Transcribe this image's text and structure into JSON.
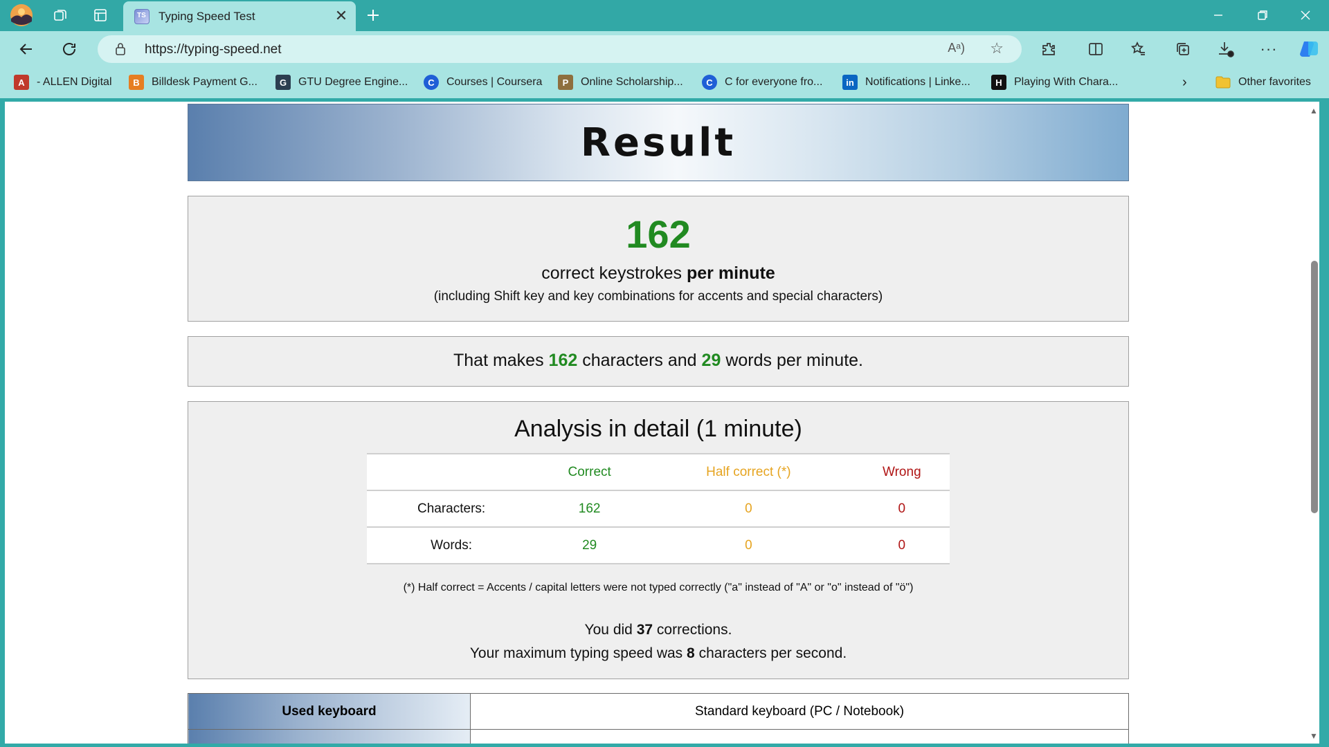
{
  "browser": {
    "tab_title": "Typing Speed Test",
    "tab_favicon_text": "TS",
    "url": "https://typing-speed.net",
    "read_aloud_icon": "A",
    "icons": [
      "profile-avatar-icon",
      "workspaces-icon",
      "vertical-tabs-icon",
      "new-tab-icon",
      "back-icon",
      "refresh-icon",
      "lock-icon",
      "star-icon",
      "extensions-icon",
      "split-screen-icon",
      "favorites-icon",
      "collections-icon",
      "downloads-icon",
      "more-icon",
      "copilot-icon"
    ],
    "favorites": [
      {
        "label": "- ALLEN Digital",
        "icon_color": "#c0392b",
        "icon_text": "A"
      },
      {
        "label": "Billdesk Payment G...",
        "icon_color": "#e67e22",
        "icon_text": "B"
      },
      {
        "label": "GTU Degree Engine...",
        "icon_color": "#2c3e50",
        "icon_text": "G"
      },
      {
        "label": "Courses | Coursera",
        "icon_color": "#1f5fd6",
        "icon_text": "C"
      },
      {
        "label": "Online Scholarship...",
        "icon_color": "#8e6f3e",
        "icon_text": "P"
      },
      {
        "label": "C for everyone fro...",
        "icon_color": "#1f5fd6",
        "icon_text": "C"
      },
      {
        "label": "Notifications | Linke...",
        "icon_color": "#0a66c2",
        "icon_text": "in"
      },
      {
        "label": "Playing With Chara...",
        "icon_color": "#111111",
        "icon_text": "H"
      },
      {
        "label": "Other favorites",
        "icon_color": "#f1c232",
        "icon_text": ""
      }
    ]
  },
  "page": {
    "title": "Result",
    "keystrokes": {
      "value": "162",
      "label_prefix": "correct keystrokes",
      "label_bold": "per minute",
      "subtext": "(including Shift key and key combinations for accents and special characters)"
    },
    "summary": {
      "prefix": "That makes",
      "characters": "162",
      "middle": "characters and",
      "words": "29",
      "suffix": "words per minute."
    },
    "analysis": {
      "title": "Analysis in detail (1 minute)",
      "headers": [
        "",
        "Correct",
        "Half correct (*)",
        "Wrong"
      ],
      "rows": [
        {
          "label": "Characters:",
          "correct": "162",
          "half": "0",
          "wrong": "0"
        },
        {
          "label": "Words:",
          "correct": "29",
          "half": "0",
          "wrong": "0"
        }
      ],
      "note": "(*) Half correct = Accents / capital letters were not typed correctly (\"a\" instead of \"A\" or \"o\" instead of \"ö\")",
      "corrections_prefix": "You did",
      "corrections": "37",
      "corrections_suffix": "corrections.",
      "max_speed_prefix": "Your maximum typing speed was",
      "max_speed": "8",
      "max_speed_suffix": "characters per second."
    },
    "keyboard": {
      "label": "Used keyboard",
      "value": "Standard keyboard (PC / Notebook)"
    }
  }
}
